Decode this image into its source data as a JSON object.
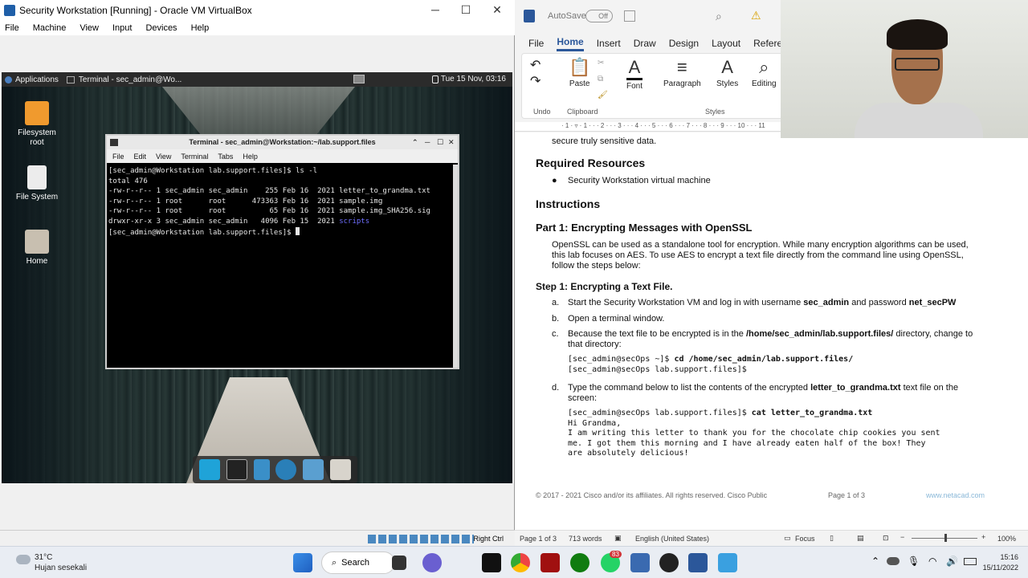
{
  "vbox": {
    "title": "Security Workstation [Running] - Oracle VM VirtualBox",
    "menu": [
      "File",
      "Machine",
      "View",
      "Input",
      "Devices",
      "Help"
    ],
    "status_right": "Right Ctrl"
  },
  "guest": {
    "panel": {
      "applications": "Applications",
      "task": "Terminal - sec_admin@Wo...",
      "clock": "Tue 15 Nov, 03:16"
    },
    "desktop_icons": [
      {
        "label": "Filesystem\nroot"
      },
      {
        "label": "File System"
      },
      {
        "label": "Home"
      }
    ],
    "terminal": {
      "title": "Terminal - sec_admin@Workstation:~/lab.support.files",
      "menu": [
        "File",
        "Edit",
        "View",
        "Terminal",
        "Tabs",
        "Help"
      ],
      "lines": [
        "[sec_admin@Workstation lab.support.files]$ ls -l",
        "total 476",
        "-rw-r--r-- 1 sec_admin sec_admin    255 Feb 16  2021 letter_to_grandma.txt",
        "-rw-r--r-- 1 root      root      473363 Feb 16  2021 sample.img",
        "-rw-r--r-- 1 root      root          65 Feb 16  2021 sample.img_SHA256.sig"
      ],
      "dir_line_prefix": "drwxr-xr-x 3 sec_admin sec_admin   4096 Feb 15  2021 ",
      "dir_name": "scripts",
      "prompt": "[sec_admin@Workstation lab.support.files]$ "
    }
  },
  "word": {
    "autosave": "AutoSave",
    "autosave_state": "Off",
    "tabs": [
      "File",
      "Home",
      "Insert",
      "Draw",
      "Design",
      "Layout",
      "Referenc"
    ],
    "ribbon": {
      "undo": "Undo",
      "paste": "Paste",
      "clipboard": "Clipboard",
      "font": "Font",
      "paragraph": "Paragraph",
      "styles": "Styles",
      "styles_group": "Styles",
      "editing": "Editing"
    },
    "doc": {
      "fragment": "secure truly sensitive data.",
      "h_required": "Required Resources",
      "bullet1": "Security Workstation virtual machine",
      "h_instructions": "Instructions",
      "h_part1": "Part 1: Encrypting Messages with OpenSSL",
      "p_openssl": "OpenSSL can be used as a standalone tool for encryption. While many encryption algorithms can be used, this lab focuses on AES. To use AES to encrypt a text file directly from the command line using OpenSSL, follow the steps below:",
      "h_step1": "Step 1: Encrypting a Text File.",
      "a_mark": "a.",
      "a_text_1": "Start the Security Workstation VM and log in with username ",
      "a_user": "sec_admin",
      "a_text_2": " and password ",
      "a_pass": "net_secPW",
      "b_mark": "b.",
      "b_text": "Open a terminal window.",
      "c_mark": "c.",
      "c_text_1": "Because the text file to be encrypted is in the ",
      "c_path": "/home/sec_admin/lab.support.files/",
      "c_text_2": " directory, change to that directory:",
      "c_code1_prompt": "[sec_admin@secOps ~]$ ",
      "c_code1_cmd": "cd /home/sec_admin/lab.support.files/",
      "c_code2": "[sec_admin@secOps lab.support.files]$",
      "d_mark": "d.",
      "d_text_1": "Type the command below to list the contents of the encrypted ",
      "d_file": "letter_to_grandma.txt",
      "d_text_2": " text file on the screen:",
      "d_code_prompt": "[sec_admin@secOps lab.support.files]$ ",
      "d_code_cmd": "cat letter_to_grandma.txt",
      "d_out1": "Hi Grandma,",
      "d_out2": "I am writing this letter to thank you for the chocolate chip cookies you sent",
      "d_out3": "me. I got them this morning and I have already eaten half of the box! They",
      "d_out4": "are absolutely delicious!",
      "footer_left": "© 2017 - 2021 Cisco and/or its affiliates. All rights reserved. Cisco Public",
      "footer_page": "Page 1 of 3",
      "footer_right": "www.netacad.com"
    },
    "status": {
      "page": "Page 1 of 3",
      "words": "713 words",
      "lang": "English (United States)",
      "focus": "Focus",
      "zoom": "100%"
    }
  },
  "taskbar": {
    "temp": "31°C",
    "weather": "Hujan sesekali",
    "search": "Search",
    "badge": "83",
    "time": "15:16",
    "date": "15/11/2022"
  }
}
